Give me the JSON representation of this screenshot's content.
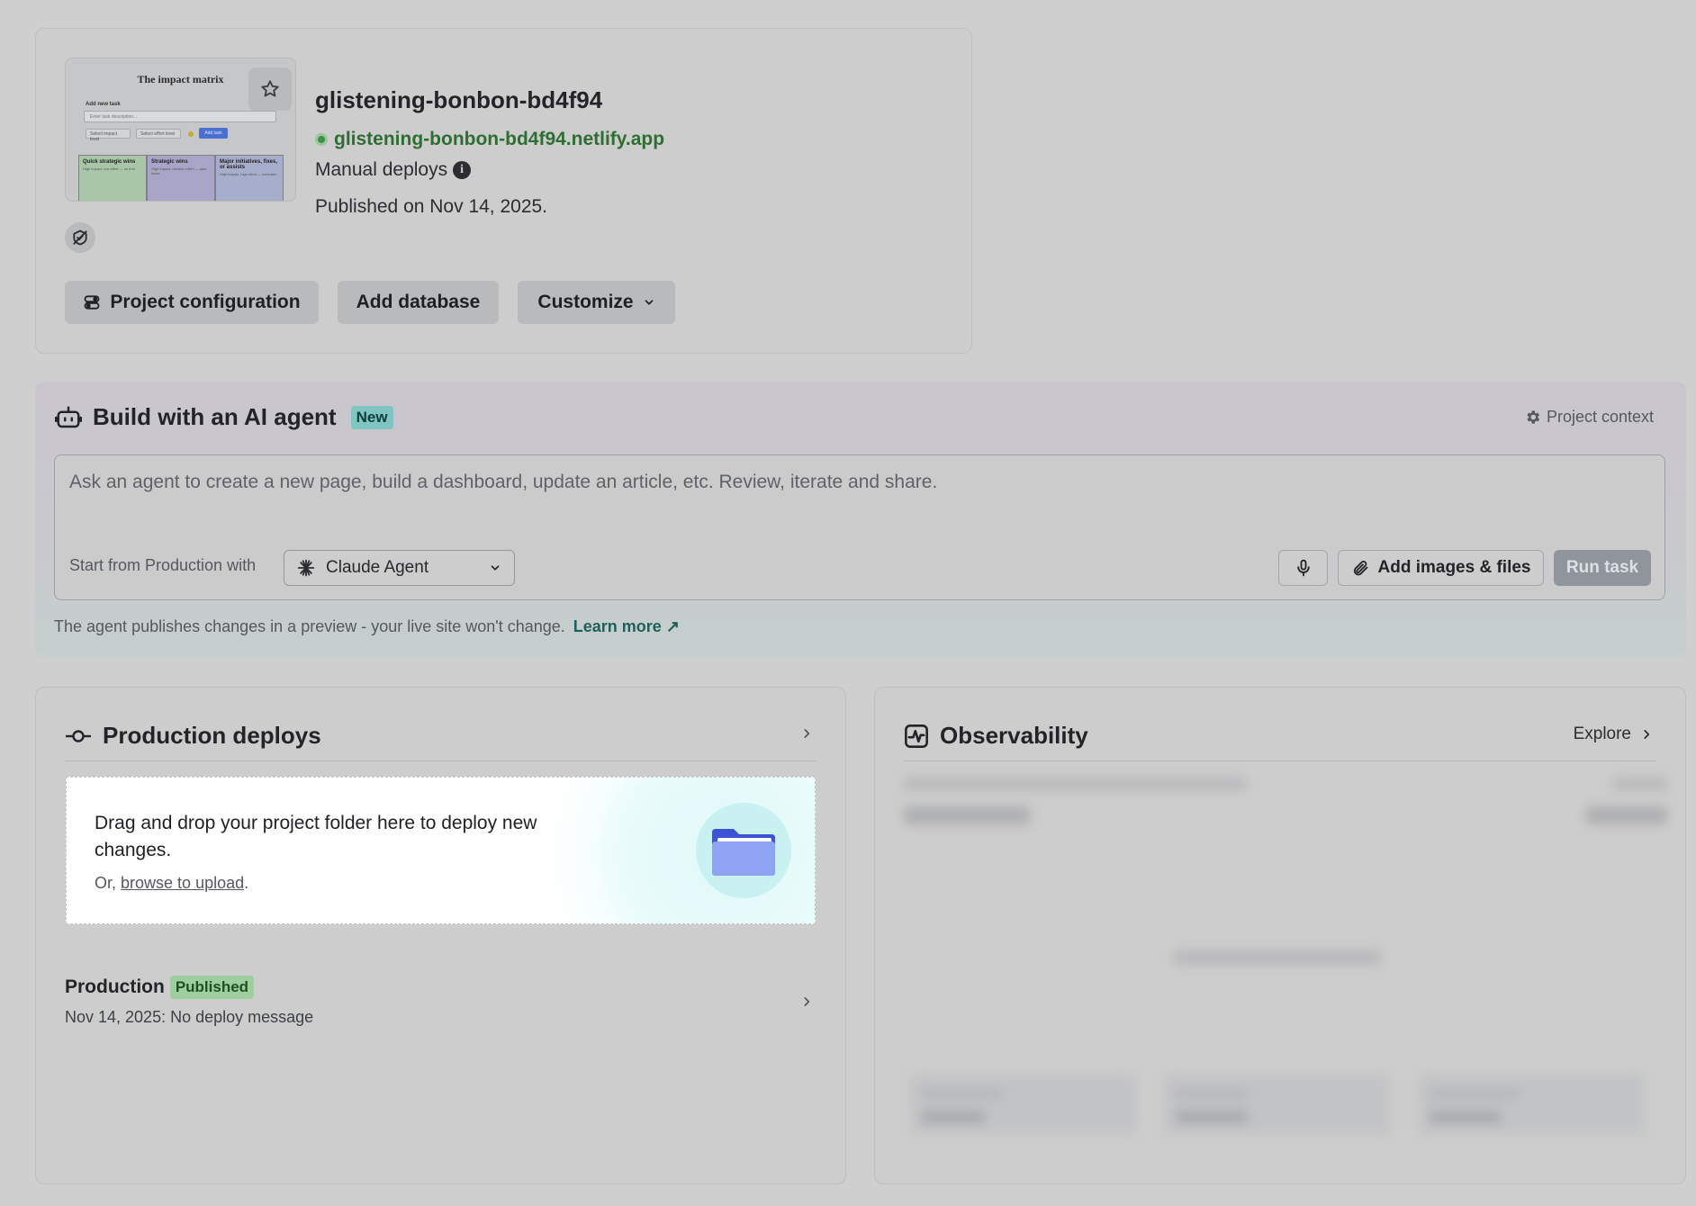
{
  "site": {
    "preview": {
      "title": "The impact matrix",
      "add_label": "Add new task",
      "input_placeholder": "Enter task description...",
      "impact_select": "Select impact level",
      "effort_select": "Select effort level",
      "add_button": "Add task",
      "quadrants": [
        {
          "title": "Quick strategic wins",
          "desc": "High impact, low effort — do first",
          "color": "#a9c6a8"
        },
        {
          "title": "Strategic wins",
          "desc": "High impact, medium effort — plan these",
          "color": "#a9a5c8"
        },
        {
          "title": "Major initiatives, fixes, or assists",
          "desc": "High impact, high effort — schedule",
          "color": "#a7aecb"
        }
      ]
    },
    "name": "glistening-bonbon-bd4f94",
    "url": "glistening-bonbon-bd4f94.netlify.app",
    "deploy_mode": "Manual deploys",
    "published": "Published on Nov 14, 2025.",
    "buttons": {
      "config": "Project configuration",
      "database": "Add database",
      "customize": "Customize"
    }
  },
  "agent": {
    "title": "Build with an AI agent",
    "badge": "New",
    "context_link": "Project context",
    "prompt_placeholder": "Ask an agent to create a new page, build a dashboard, update an article, etc. Review, iterate and share.",
    "start_from": "Start from Production with",
    "selected_agent": "Claude Agent",
    "attach_label": "Add images & files",
    "run_label": "Run task",
    "note": "The agent publishes changes in a preview - your live site won't change.",
    "learn_more": "Learn more ↗"
  },
  "deploys": {
    "title": "Production deploys",
    "drop_text": "Drag and drop your project folder here to deploy new changes.",
    "drop_or": "Or,",
    "browse_link": "browse to upload",
    "drop_period": ".",
    "production": {
      "label": "Production",
      "badge": "Published",
      "message": "Nov 14, 2025: No deploy message"
    }
  },
  "observability": {
    "title": "Observability",
    "explore": "Explore"
  },
  "colors": {
    "background": "#cfcfcf",
    "url_green": "#2e6e33",
    "new_badge": "#7fc6c1",
    "published_badge": "#9ccf9d",
    "run_button": "#90959c"
  },
  "icons": [
    "star-icon",
    "info-icon",
    "verified-icon",
    "toggle-config-icon",
    "chevron-down-icon",
    "robot-icon",
    "gear-icon",
    "claude-asterisk-icon",
    "microphone-icon",
    "paperclip-icon",
    "commit-icon",
    "chevron-right-icon",
    "folder-icon",
    "activity-icon"
  ]
}
